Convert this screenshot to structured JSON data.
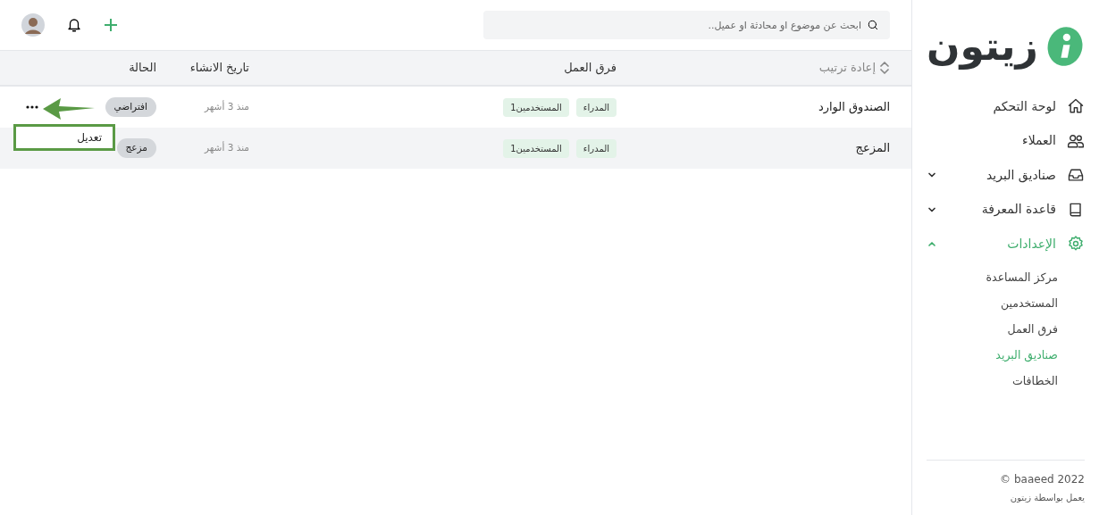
{
  "sidebar": {
    "logo": "زيتون",
    "items": [
      {
        "label": "لوحة التحكم",
        "kind": "home",
        "selected": false
      },
      {
        "label": "العملاء",
        "kind": "users",
        "selected": false
      },
      {
        "label": "صناديق البريد",
        "kind": "inbox",
        "selected": false,
        "expanded": false
      },
      {
        "label": "قاعدة المعرفة",
        "kind": "book",
        "selected": false,
        "expanded": false
      },
      {
        "label": "الإعدادات",
        "kind": "gear",
        "selected": true,
        "expanded": true,
        "children": [
          {
            "label": "مركز المساعدة",
            "selected": false
          },
          {
            "label": "المستخدمين",
            "selected": false
          },
          {
            "label": "فرق العمل",
            "selected": false
          },
          {
            "label": "صناديق البريد",
            "selected": true
          },
          {
            "label": "الخطافات",
            "selected": false
          }
        ]
      }
    ],
    "footer": {
      "copyright": "baaeed 2022 ©",
      "powered": "يعمل بواسطة زيتون"
    }
  },
  "search": {
    "placeholder": "ابحث عن موضوع او محادثة او عميل.."
  },
  "table": {
    "columns": [
      {
        "label": "إعادة ترتيب",
        "kind": "sort"
      },
      {
        "label": "فرق العمل",
        "kind": "text"
      },
      {
        "label": "تاريخ الانشاء",
        "kind": "text"
      },
      {
        "label": "الحالة",
        "kind": "text"
      }
    ],
    "rows": [
      {
        "name": "الصندوق الوارد",
        "teams": [
          "المدراء",
          "المستخدمين1"
        ],
        "created": "منذ 3 أشهر",
        "status": "افتراضي",
        "hovered": false,
        "menu_open": true
      },
      {
        "name": "المزعج",
        "teams": [
          "المدراء",
          "المستخدمين1"
        ],
        "created": "منذ 3 أشهر",
        "status": "مزعج",
        "hovered": true,
        "menu_open": false
      }
    ]
  },
  "row_menu": {
    "items": [
      "تعديل"
    ]
  }
}
